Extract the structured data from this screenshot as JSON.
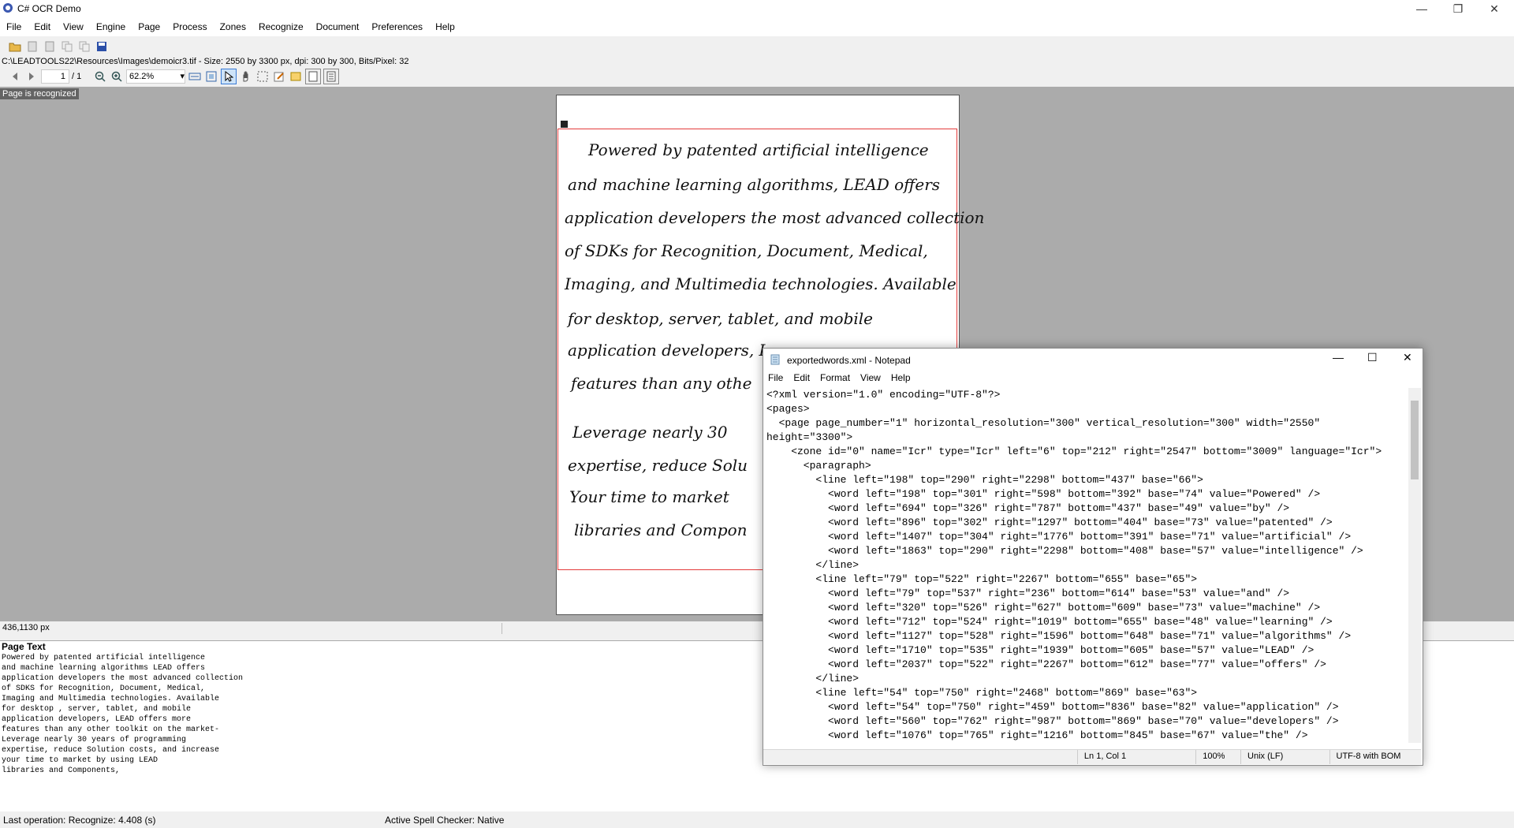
{
  "window": {
    "title": "C# OCR Demo",
    "controls": [
      "minimize-icon",
      "restore-icon",
      "close-icon"
    ]
  },
  "menu": [
    "File",
    "Edit",
    "View",
    "Engine",
    "Page",
    "Process",
    "Zones",
    "Recognize",
    "Document",
    "Preferences",
    "Help"
  ],
  "image_info": "C:\\LEADTOOLS22\\Resources\\Images\\demoicr3.tif - Size: 2550 by 3300 px, dpi: 300 by 300, Bits/Pixel: 32",
  "nav": {
    "page": "1",
    "page_total": "/ 1",
    "zoom": "62.2%"
  },
  "status_badge": "Page is recognized",
  "handwriting": [
    "Powered by patented artificial intelligence",
    "and machine learning algorithms, LEAD offers",
    "application developers the most advanced collection",
    "of SDKs for Recognition, Document, Medical,",
    "Imaging, and Multimedia technologies. Available",
    "for desktop, server, tablet, and mobile",
    "application developers, L",
    "features than any othe",
    "Leverage nearly 30",
    "expertise, reduce Solu",
    "Your time to market",
    "libraries and Compon"
  ],
  "coord_readout": "436,1130 px",
  "page_text": {
    "title": "Page Text",
    "lines": [
      "Powered by patented artificial intelligence",
      "and machine learning algorithms LEAD offers",
      "application developers the most advanced collection",
      "of SDKS for Recognition, Document, Medical,",
      "Imaging and Multimedia technologies. Available",
      "for desktop , server, tablet, and mobile",
      "application developers, LEAD offers more",
      "features than any other toolkit on the market-",
      "Leverage nearly 30 years of programming",
      "expertise, reduce Solution costs, and increase",
      "your time to market by using LEAD",
      "libraries and Components,"
    ]
  },
  "status": {
    "last_operation": "Last operation:  Recognize: 4.408 (s)",
    "spell_checker": "Active Spell Checker:  Native"
  },
  "notepad": {
    "title": "exportedwords.xml - Notepad",
    "menu": [
      "File",
      "Edit",
      "Format",
      "View",
      "Help"
    ],
    "lines": [
      "<?xml version=\"1.0\" encoding=\"UTF-8\"?>",
      "<pages>",
      "  <page page_number=\"1\" horizontal_resolution=\"300\" vertical_resolution=\"300\" width=\"2550\"",
      "height=\"3300\">",
      "    <zone id=\"0\" name=\"Icr\" type=\"Icr\" left=\"6\" top=\"212\" right=\"2547\" bottom=\"3009\" language=\"Icr\">",
      "      <paragraph>",
      "        <line left=\"198\" top=\"290\" right=\"2298\" bottom=\"437\" base=\"66\">",
      "          <word left=\"198\" top=\"301\" right=\"598\" bottom=\"392\" base=\"74\" value=\"Powered\" />",
      "          <word left=\"694\" top=\"326\" right=\"787\" bottom=\"437\" base=\"49\" value=\"by\" />",
      "          <word left=\"896\" top=\"302\" right=\"1297\" bottom=\"404\" base=\"73\" value=\"patented\" />",
      "          <word left=\"1407\" top=\"304\" right=\"1776\" bottom=\"391\" base=\"71\" value=\"artificial\" />",
      "          <word left=\"1863\" top=\"290\" right=\"2298\" bottom=\"408\" base=\"57\" value=\"intelligence\" />",
      "        </line>",
      "        <line left=\"79\" top=\"522\" right=\"2267\" bottom=\"655\" base=\"65\">",
      "          <word left=\"79\" top=\"537\" right=\"236\" bottom=\"614\" base=\"53\" value=\"and\" />",
      "          <word left=\"320\" top=\"526\" right=\"627\" bottom=\"609\" base=\"73\" value=\"machine\" />",
      "          <word left=\"712\" top=\"524\" right=\"1019\" bottom=\"655\" base=\"48\" value=\"learning\" />",
      "          <word left=\"1127\" top=\"528\" right=\"1596\" bottom=\"648\" base=\"71\" value=\"algorithms\" />",
      "          <word left=\"1710\" top=\"535\" right=\"1939\" bottom=\"605\" base=\"57\" value=\"LEAD\" />",
      "          <word left=\"2037\" top=\"522\" right=\"2267\" bottom=\"612\" base=\"77\" value=\"offers\" />",
      "        </line>",
      "        <line left=\"54\" top=\"750\" right=\"2468\" bottom=\"869\" base=\"63\">",
      "          <word left=\"54\" top=\"750\" right=\"459\" bottom=\"836\" base=\"82\" value=\"application\" />",
      "          <word left=\"560\" top=\"762\" right=\"987\" bottom=\"869\" base=\"70\" value=\"developers\" />",
      "          <word left=\"1076\" top=\"765\" right=\"1216\" bottom=\"845\" base=\"67\" value=\"the\" />"
    ],
    "status": {
      "position": "Ln 1, Col 1",
      "zoom": "100%",
      "eol": "Unix (LF)",
      "encoding": "UTF-8 with BOM"
    }
  }
}
